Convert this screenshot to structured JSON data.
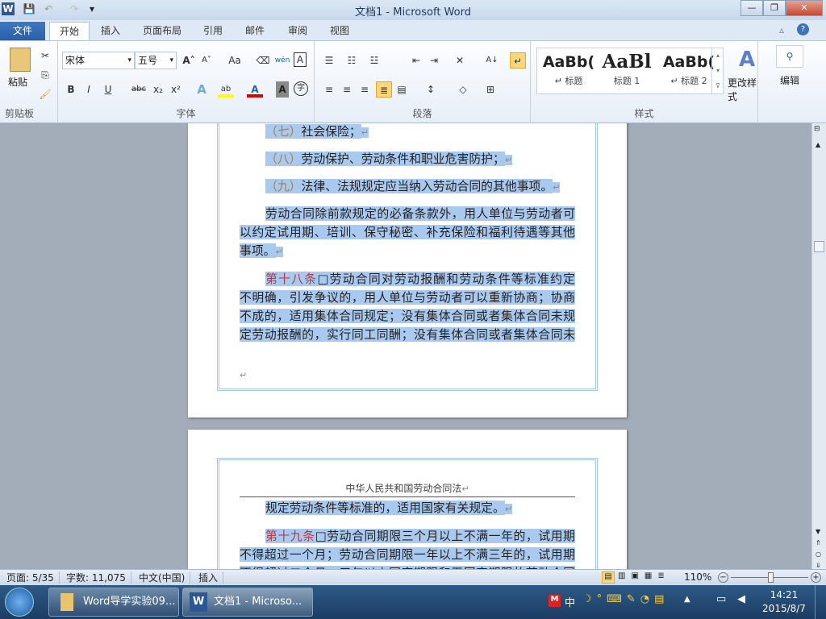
{
  "window": {
    "title": "文档1  -  Microsoft Word",
    "min": "—",
    "restore": "❐",
    "close": "✕"
  },
  "quick_access": {
    "word_icon": "W",
    "save": "💾",
    "undo": "↶",
    "redo": "↷",
    "customize": "▾"
  },
  "tabs": [
    "文件",
    "开始",
    "插入",
    "页面布局",
    "引用",
    "邮件",
    "审阅",
    "视图"
  ],
  "ribbon": {
    "clipboard": {
      "paste": "粘贴",
      "label": "剪贴板"
    },
    "font": {
      "name": "宋体",
      "size": "五号",
      "label": "字体",
      "bold": "B",
      "italic": "I",
      "underline": "U",
      "strike": "abc",
      "sub": "x₂",
      "sup": "x²",
      "grow": "A˄",
      "shrink": "A˅",
      "case": "Aa",
      "pinyin": "wén",
      "border_char": "A",
      "color_A": "A",
      "shade_A": "A",
      "enclose": "字"
    },
    "paragraph": {
      "label": "段落"
    },
    "styles": {
      "label": "样式",
      "items": [
        {
          "preview": "AaBb(",
          "name": "↵ 标题"
        },
        {
          "preview": "AaBl",
          "name": "标题 1"
        },
        {
          "preview": "AaBb(",
          "name": "↵ 标题 2"
        }
      ],
      "change": "更改样式"
    },
    "editing": {
      "label": "编辑"
    }
  },
  "document": {
    "page1": [
      {
        "num": "（七）",
        "text": "社会保险；"
      },
      {
        "num": "（八）",
        "text": "劳动保护、劳动条件和职业危害防护；"
      },
      {
        "num": "（九）",
        "text": "法律、法规规定应当纳入劳动合同的其他事项。"
      },
      {
        "lines": [
          "劳动合同除前款规定的必备条款外，用人单位与劳动者可",
          "以约定试用期、培训、保守秘密、补充保险和福利待遇等其他",
          "事项。"
        ]
      },
      {
        "article": "第十八条",
        "lines": [
          "□劳动合同对劳动报酬和劳动条件等标准约定",
          "不明确，引发争议的，用人单位与劳动者可以重新协商；协商",
          "不成的，适用集体合同规定；没有集体合同或者集体合同未规",
          "定劳动报酬的，实行同工同酬；没有集体合同或者集体合同未"
        ]
      }
    ],
    "page2_header": "中华人民共和国劳动合同法",
    "page2": [
      {
        "lines": [
          "规定劳动条件等标准的，适用国家有关规定。"
        ]
      },
      {
        "article": "第十九条",
        "lines": [
          "□劳动合同期限三个月以上不满一年的，试用期",
          "不得超过一个月；劳动合同期限一年以上不满三年的，试用期",
          "不得超过二个月；三年以上固定期限和无固定期限的劳动合同"
        ]
      }
    ]
  },
  "status": {
    "page": "页面: 5/35",
    "words": "字数: 11,075",
    "lang": "中文(中国)",
    "mode": "插入",
    "zoom": "110%",
    "zoom_percent": 110
  },
  "taskbar": {
    "items": [
      "Word导学实验09...",
      "文档1 - Microso..."
    ],
    "time": "14:21",
    "date": "2015/8/7",
    "ime": "中"
  }
}
